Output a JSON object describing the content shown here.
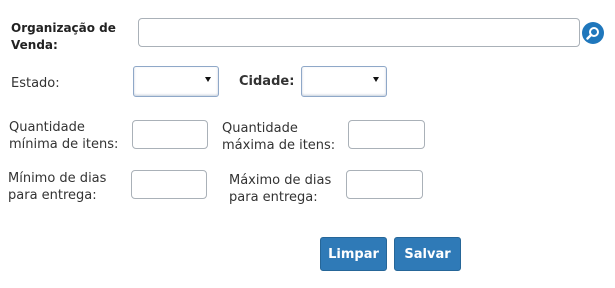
{
  "form": {
    "organizacao": {
      "label_line1": "Organização de",
      "label_line2": "Venda:",
      "value": ""
    },
    "search_icon": "search-icon",
    "estado": {
      "label": "Estado:",
      "selected": ""
    },
    "cidade": {
      "label": "Cidade:",
      "selected": ""
    },
    "qtd_min": {
      "label_line1": "Quantidade",
      "label_line2": "mínima de itens:",
      "value": ""
    },
    "qtd_max": {
      "label_line1": "Quantidade",
      "label_line2": "máxima de itens:",
      "value": ""
    },
    "dias_min": {
      "label_line1": "Mínimo de dias",
      "label_line2": "para entrega:",
      "value": ""
    },
    "dias_max": {
      "label_line1": "Máximo de dias",
      "label_line2": "para entrega:",
      "value": ""
    }
  },
  "actions": {
    "limpar": "Limpar",
    "salvar": "Salvar"
  },
  "colors": {
    "button": "#2f7ab7",
    "search_icon_bg": "#1f77bc"
  }
}
